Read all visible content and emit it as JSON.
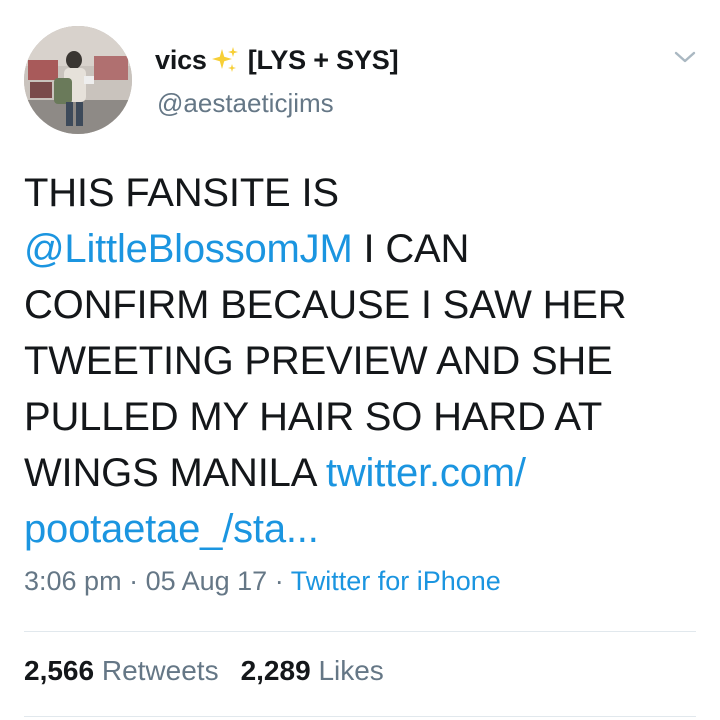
{
  "author": {
    "display_name": "vics",
    "name_suffix": "[LYS + SYS]",
    "username": "@aestaeticjims",
    "avatar_icon": "profile-photo",
    "badge_icon": "sparkles-icon"
  },
  "tweet": {
    "lines": [
      [
        {
          "text": "THIS FANSITE IS",
          "link": false
        }
      ],
      [
        {
          "text": "@LittleBlossomJM",
          "link": true
        },
        {
          "text": " I CAN",
          "link": false
        }
      ],
      [
        {
          "text": "CONFIRM BECAUSE I SAW HER",
          "link": false
        }
      ],
      [
        {
          "text": "TWEETING PREVIEW AND SHE",
          "link": false
        }
      ],
      [
        {
          "text": "PULLED MY HAIR SO HARD AT",
          "link": false
        }
      ],
      [
        {
          "text": "WINGS MANILA ",
          "link": false
        },
        {
          "text": "twitter.com/",
          "link": true
        }
      ],
      [
        {
          "text": "pootaetae_/sta...",
          "link": true
        }
      ]
    ]
  },
  "meta": {
    "time": "3:06 pm",
    "date": "05 Aug 17",
    "separator": " · ",
    "source": "Twitter for iPhone"
  },
  "stats": {
    "retweets_count": "2,566",
    "retweets_label": "Retweets",
    "likes_count": "2,289",
    "likes_label": "Likes"
  },
  "colors": {
    "link": "#1b95e0",
    "secondary_text": "#657786",
    "primary_text": "#14171a",
    "divider": "#e1e8ed",
    "sparkle": "#f5c518"
  }
}
